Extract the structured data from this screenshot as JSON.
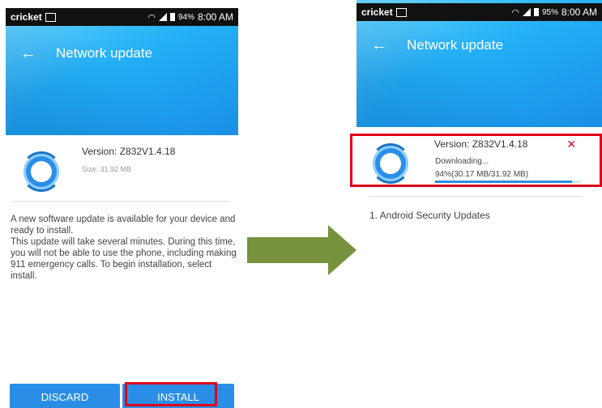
{
  "left": {
    "status": {
      "carrier": "cricket",
      "battery": "94%",
      "time": "8:00 AM"
    },
    "title": "Network update",
    "version": "Version: Z832V1.4.18",
    "size": "Size: 31.92 MB",
    "description": [
      "A new software update is available for your device and ready to install.",
      "This update will take several minutes. During this time, you will not be able to use the phone, including making 911 emergency calls. To begin installation, select install."
    ],
    "buttons": {
      "discard": "DISCARD",
      "install": "INSTALL"
    }
  },
  "right": {
    "status": {
      "carrier": "cricket",
      "battery": "95%",
      "time": "8:00 AM"
    },
    "title": "Network update",
    "version": "Version: Z832V1.4.18",
    "downloading": "Downloading...",
    "progress_text": "94%(30.17 MB/31.92 MB)",
    "progress_value": 0.94,
    "close_icon": "×",
    "updates": [
      "1. Android Security Updates"
    ]
  },
  "colors": {
    "accent": "#2a8ee6",
    "highlight": "#e0001a",
    "arrow": "#76923c"
  },
  "icons": {
    "back": "←"
  }
}
